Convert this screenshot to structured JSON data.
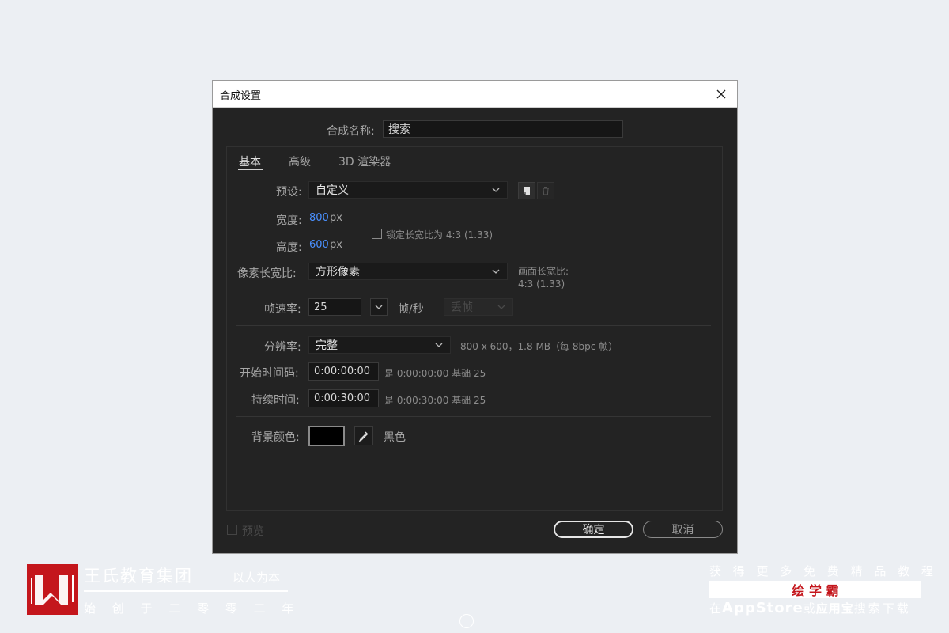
{
  "dialog": {
    "title": "合成设置",
    "comp_name_label": "合成名称:",
    "comp_name_value": "搜索",
    "tabs": [
      "基本",
      "高级",
      "3D 渲染器"
    ],
    "preset_label": "预设:",
    "preset_value": "自定义",
    "width_label": "宽度:",
    "width_value": "800",
    "width_unit": "px",
    "height_label": "高度:",
    "height_value": "600",
    "height_unit": "px",
    "lock_aspect_label": "锁定长宽比为 4:3 (1.33)",
    "pixel_aspect_label": "像素长宽比:",
    "pixel_aspect_value": "方形像素",
    "frame_aspect_label": "画面长宽比:",
    "frame_aspect_value": "4:3 (1.33)",
    "frame_rate_label": "帧速率:",
    "frame_rate_value": "25",
    "frame_rate_unit": "帧/秒",
    "drop_frame_label": "丢帧",
    "resolution_label": "分辨率:",
    "resolution_value": "完整",
    "resolution_info": "800 x 600，1.8 MB（每 8bpc 帧）",
    "start_tc_label": "开始时间码:",
    "start_tc_value": "0:00:00:00",
    "start_tc_info": "是 0:00:00:00  基础 25",
    "duration_label": "持续时间:",
    "duration_value": "0:00:30:00",
    "duration_info": "是 0:00:30:00  基础 25",
    "bg_color_label": "背景颜色:",
    "bg_color_name": "黑色",
    "bg_color_hex": "#000000",
    "preview_label": "预览",
    "ok_label": "确定",
    "cancel_label": "取消"
  },
  "watermark_left": {
    "brand": "王氏教育集团",
    "slogan": "以人为本",
    "since": "始 创 于 二 零 零 二 年"
  },
  "watermark_right": {
    "line1": "获 得 更 多 免 费 精 品 教 程",
    "app_name": "绘 学 霸",
    "line3_prefix": "在",
    "line3_store1": "AppStore",
    "line3_mid": "或",
    "line3_store2": "应用宝",
    "line3_suffix": "搜索下载"
  },
  "colors": {
    "accent_blue": "#4a90ff",
    "brand_red": "#c4161c"
  }
}
